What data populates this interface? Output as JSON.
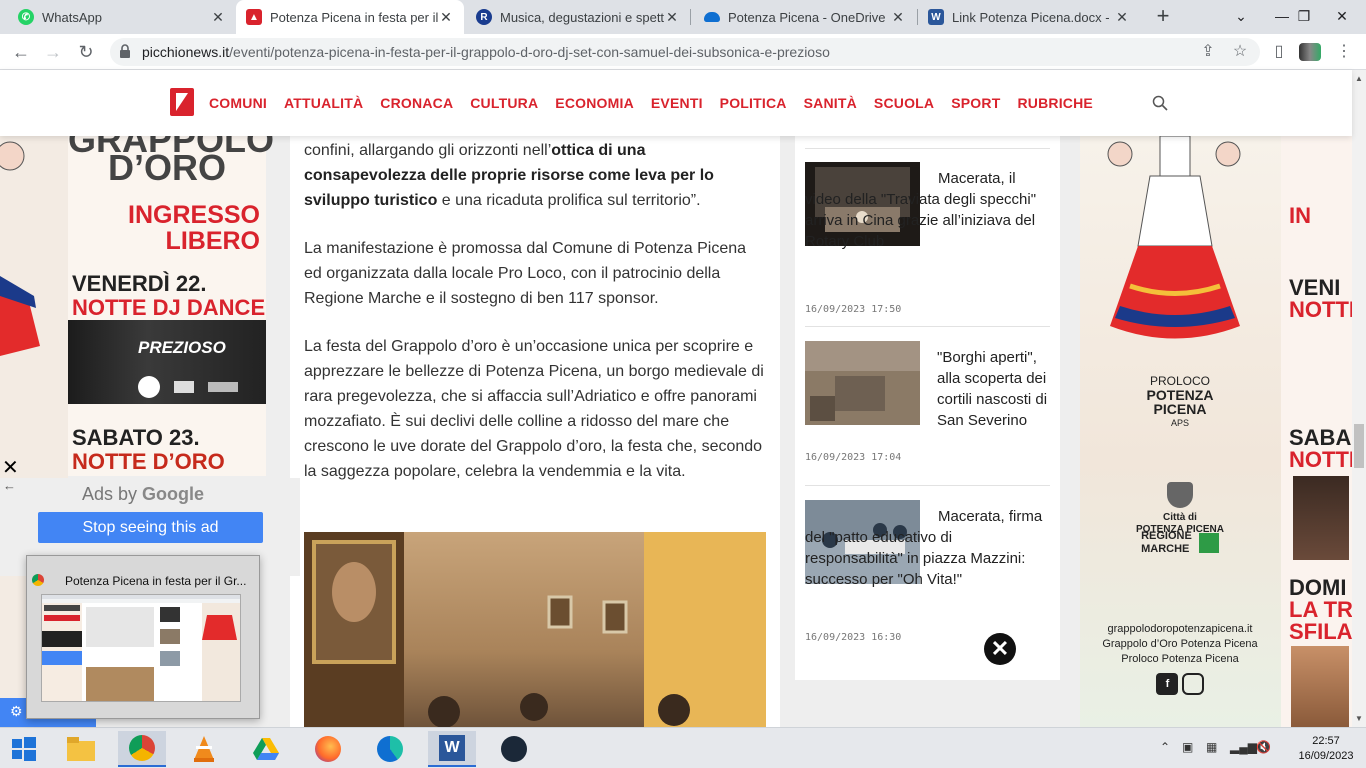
{
  "browser": {
    "tabs": [
      {
        "title": "WhatsApp",
        "favicon_color": "#25d366",
        "active": false
      },
      {
        "title": "Potenza Picena in festa per il G",
        "favicon_color": "#d9232d",
        "active": true
      },
      {
        "title": "Musica, degustazioni e spettac",
        "favicon_color": "#1a3c8f",
        "active": false
      },
      {
        "title": "Potenza Picena - OneDrive",
        "favicon_color": "#0f6fd1",
        "active": false
      },
      {
        "title": "Link Potenza Picena.docx - Mic",
        "favicon_color": "#2b579a",
        "active": false
      }
    ],
    "new_tab": "+",
    "url_host": "picchionews.it",
    "url_path": "/eventi/potenza-picena-in-festa-per-il-grappolo-d-oro-dj-set-con-samuel-dei-subsonica-e-prezioso"
  },
  "site": {
    "nav": [
      "COMUNI",
      "ATTUALITÀ",
      "CRONACA",
      "CULTURA",
      "ECONOMIA",
      "EVENTI",
      "POLITICA",
      "SANITÀ",
      "SCUOLA",
      "SPORT",
      "RUBRICHE"
    ],
    "accent": "#d9232d"
  },
  "article": {
    "p1_a": "confini, allargando gli orizzonti nell’",
    "p1_b": "ottica di una consapevolezza delle proprie risorse come leva per lo sviluppo turistico",
    "p1_c": " e una ricaduta prolifica sul territorio”.",
    "p2": "La manifestazione è promossa dal Comune di Potenza Picena ed organizzata dalla locale Pro Loco, con il patrocinio della Regione Marche e il sostegno di ben 117 sponsor.",
    "p3": "La festa del Grappolo d’oro è un’occasione unica per scoprire e apprezzare le bellezze di Potenza Picena, un borgo medievale di rara pregevolezza, che si affaccia sull’Adriatico e offre panorami mozzafiato.  È sui declivi delle colline a ridosso del mare che crescono le uve dorate del Grappolo d’oro, la festa che, secondo la saggezza popolare, celebra la vendemmia e la vita."
  },
  "sidebar": {
    "items": [
      {
        "title": "Macerata, il video della \"Traviata degli specchi\" arriva in Cina grazie all’iniziava del Rotary Club",
        "date": "16/09/2023 17:50"
      },
      {
        "title": "\"Borghi aperti\", alla scoperta dei cortili nascosti di San Severino",
        "date": "16/09/2023 17:04"
      },
      {
        "title": "Macerata, firma del \"patto educativo di responsabilità\" in piazza Mazzini: successo per \"Oh Vita!\"",
        "date": "16/09/2023 16:30"
      }
    ]
  },
  "ads": {
    "left": {
      "line1": "GRAPPOLO",
      "line2": "D’ORO",
      "line3": "INGRESSO",
      "line4": "LIBERO",
      "line5": "VENERDÌ 22.",
      "line6": "NOTTE DJ DANCE",
      "line7": "PREZIOSO",
      "line8": "SABATO 23.",
      "line9": "NOTTE D’ORO"
    },
    "right": {
      "proloco1": "PROLOCO",
      "proloco2": "POTENZA",
      "proloco3": "PICENA",
      "proloco4": "APS",
      "citta1": "Città di",
      "citta2": "POTENZA PICENA",
      "regione1": "REGIONE",
      "regione2": "MARCHE",
      "site": "grappolodoropotenzapicena.it",
      "social1": "Grappolo d’Oro Potenza Picena",
      "social2": "Proloco Potenza Picena",
      "strip": [
        "IN",
        "VENI",
        "NOTTE",
        "SABA",
        "NOTTE",
        "DOMI",
        "LA TR",
        "SFILA"
      ]
    },
    "ads_by": "Ads by",
    "google": "Google",
    "stop_label": "Stop seeing this ad",
    "close_x": "✕",
    "back_arrow": "←"
  },
  "preview": {
    "title": "Potenza Picena in festa per il Gr..."
  },
  "taskbar": {
    "time": "22:57",
    "date": "16/09/2023"
  }
}
